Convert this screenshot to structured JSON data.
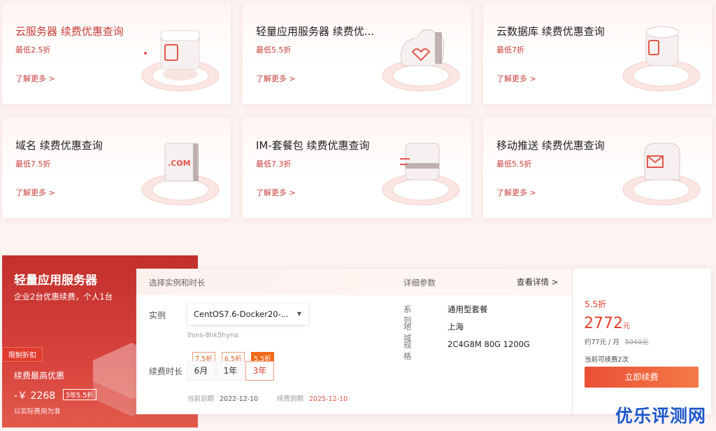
{
  "cards": [
    {
      "title": "云服务器 续费优惠查询",
      "discount": "最低2.5折",
      "more": "了解更多 >",
      "icon": "cloud-server-icon"
    },
    {
      "title": "轻量应用服务器 续费优...",
      "discount": "最低5.5折",
      "more": "了解更多 >",
      "icon": "lighthouse-icon"
    },
    {
      "title": "云数据库 续费优惠查询",
      "discount": "最低7折",
      "more": "了解更多 >",
      "icon": "database-icon"
    },
    {
      "title": "域名 续费优惠查询",
      "discount": "最低7.5折",
      "more": "了解更多 >",
      "icon": "domain-icon",
      "icon_text": ".COM"
    },
    {
      "title": "IM-套餐包 续费优惠查询",
      "discount": "最低7.3折",
      "more": "了解更多 >",
      "icon": "im-icon"
    },
    {
      "title": "移动推送 续费优惠查询",
      "discount": "最低5.5折",
      "more": "了解更多 >",
      "icon": "push-icon"
    }
  ],
  "promo": {
    "title": "轻量应用服务器",
    "subtitle": "企业2台优惠续费，个人1台",
    "tag": "限制折扣",
    "best": "续费最高优惠",
    "save": "-￥ 2268",
    "save_pill": "3年5.5折",
    "note": "以实际费用为准"
  },
  "panel": {
    "select_header": "选择实例和时长",
    "detail_header": "详细参数",
    "detail_link": "查看详情 >",
    "instance_label": "实例",
    "instance_value": "CentOS7.6-Docker20-...",
    "instance_id": "lhins-8hk5hyna",
    "duration_label": "续费时长",
    "durations": [
      {
        "discount": "7.5折",
        "label": "6月"
      },
      {
        "discount": "6.5折",
        "label": "1年"
      },
      {
        "discount": "5.5折",
        "label": "3年"
      }
    ],
    "current_expire_label": "当前到期",
    "current_expire": "2022-12-10",
    "renew_expire_label": "续费到期",
    "renew_expire": "2025-12-10",
    "specs": [
      {
        "k": "系列",
        "v": "通用型套餐"
      },
      {
        "k": "地域",
        "v": "上海"
      },
      {
        "k": "规格",
        "v": "2C4G8M 80G 1200G"
      }
    ]
  },
  "price": {
    "discount": "5.5折",
    "amount": "2772",
    "unit": "元",
    "per_month": "约77元 / 月",
    "original": "5040元",
    "renew_left": "当前可续费2次",
    "button": "立即续费"
  },
  "watermark": "优乐评测网",
  "colors": {
    "accent": "#c5413d",
    "orange": "#f26a1b",
    "banner": "#c3302c"
  }
}
